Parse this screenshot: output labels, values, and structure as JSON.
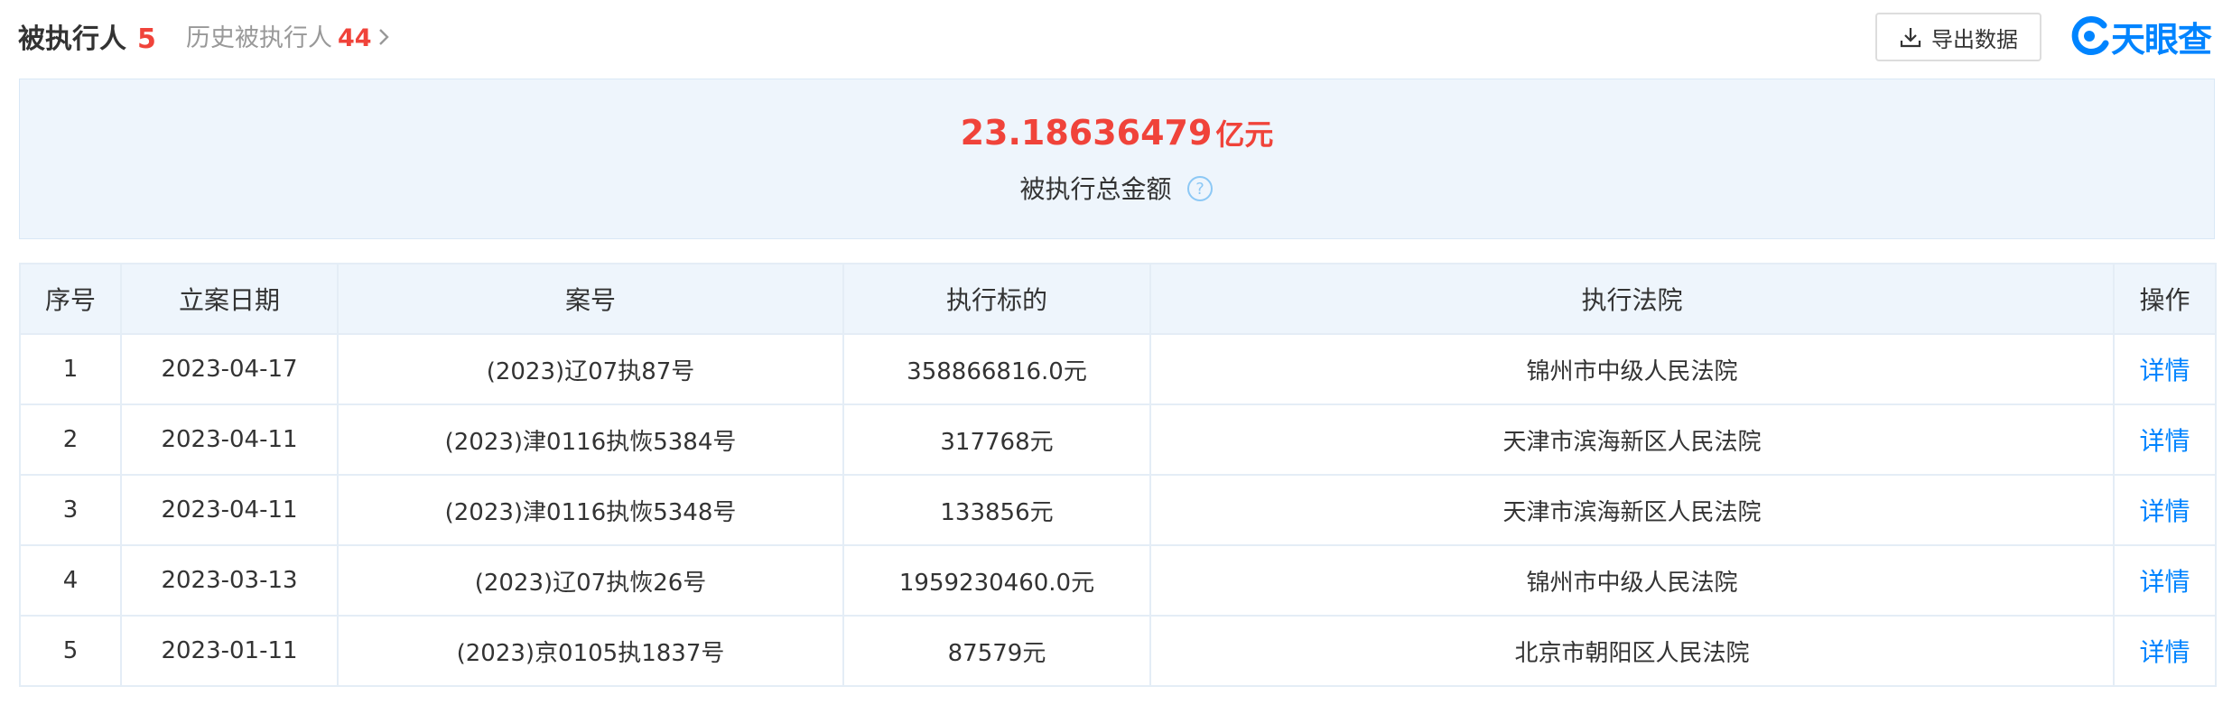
{
  "tabs": {
    "executed_label": "被执行人",
    "executed_count": "5",
    "history_label": "历史被执行人",
    "history_count": "44"
  },
  "toolbar": {
    "export_label": "导出数据",
    "logo_text": "天眼查"
  },
  "summary": {
    "amount": "23.18636479",
    "unit": "亿元",
    "label": "被执行总金额"
  },
  "table": {
    "headers": [
      "序号",
      "立案日期",
      "案号",
      "执行标的",
      "执行法院",
      "操作"
    ],
    "rows": [
      {
        "no": "1",
        "date": "2023-04-17",
        "case_no": "(2023)辽07执87号",
        "amount": "358866816.0元",
        "court": "锦州市中级人民法院",
        "action": "详情"
      },
      {
        "no": "2",
        "date": "2023-04-11",
        "case_no": "(2023)津0116执恢5384号",
        "amount": "317768元",
        "court": "天津市滨海新区人民法院",
        "action": "详情"
      },
      {
        "no": "3",
        "date": "2023-04-11",
        "case_no": "(2023)津0116执恢5348号",
        "amount": "133856元",
        "court": "天津市滨海新区人民法院",
        "action": "详情"
      },
      {
        "no": "4",
        "date": "2023-03-13",
        "case_no": "(2023)辽07执恢26号",
        "amount": "1959230460.0元",
        "court": "锦州市中级人民法院",
        "action": "详情"
      },
      {
        "no": "5",
        "date": "2023-01-11",
        "case_no": "(2023)京0105执1837号",
        "amount": "87579元",
        "court": "北京市朝阳区人民法院",
        "action": "详情"
      }
    ]
  },
  "colors": {
    "accent_red": "#f0433a",
    "link_blue": "#0084ff",
    "header_bg": "#eef5fc"
  },
  "icons": {
    "export": "download-icon",
    "help": "question-circle-icon",
    "chevron": "chevron-right-icon",
    "logo": "tianyancha-logo-icon"
  }
}
